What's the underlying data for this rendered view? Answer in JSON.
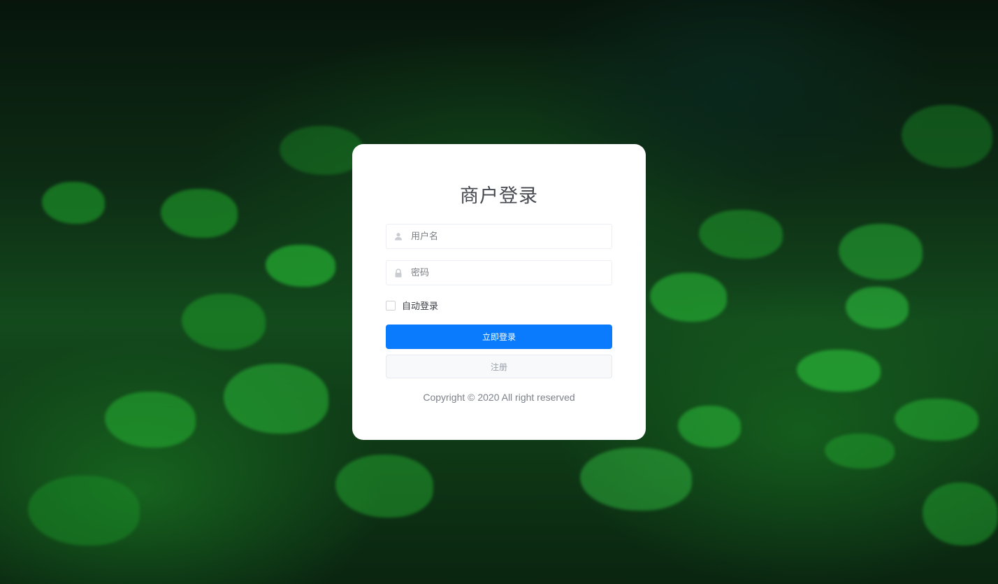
{
  "login": {
    "title": "商户登录",
    "username_placeholder": "用户名",
    "password_placeholder": "密码",
    "remember_label": "自动登录",
    "login_button": "立即登录",
    "register_button": "注册",
    "copyright": "Copyright © 2020 All right reserved"
  },
  "icons": {
    "username": "user-icon",
    "password": "lock-icon"
  },
  "colors": {
    "primary": "#0a7bfd",
    "card_background": "#ffffff",
    "title_text": "#45494f"
  }
}
